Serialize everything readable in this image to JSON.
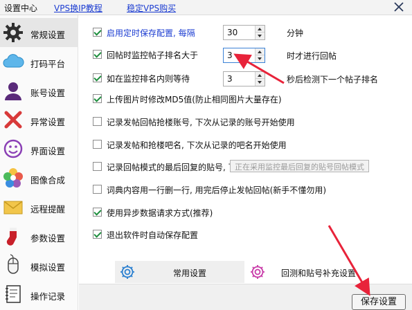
{
  "titlebar": {
    "title": "设置中心",
    "link1": "VPS换IP教程",
    "link2": "稳定VPS购买"
  },
  "sidebar": {
    "items": [
      {
        "label": "常规设置",
        "icon": "gear-icon"
      },
      {
        "label": "打码平台",
        "icon": "cloud-icon"
      },
      {
        "label": "账号设置",
        "icon": "user-icon"
      },
      {
        "label": "异常设置",
        "icon": "cross-icon"
      },
      {
        "label": "界面设置",
        "icon": "smiley-icon"
      },
      {
        "label": "图像合成",
        "icon": "flower-icon"
      },
      {
        "label": "远程提醒",
        "icon": "envelope-icon"
      },
      {
        "label": "参数设置",
        "icon": "sock-icon"
      },
      {
        "label": "模拟设置",
        "icon": "mouse-icon"
      },
      {
        "label": "操作记录",
        "icon": "notebook-icon"
      }
    ]
  },
  "settings": {
    "auto_save": {
      "label": "启用定时保存配置, 每隔",
      "value": "30",
      "unit": "分钟",
      "checked": true
    },
    "monitor_rank": {
      "label": "回帖时监控帖子排名大于",
      "value": "3",
      "unit": "时才进行回帖",
      "checked": true
    },
    "wait_in_rank": {
      "label": "如在监控排名内则等待",
      "value": "3",
      "unit": "秒后检测下一个帖子排名",
      "checked": true
    },
    "md5": {
      "label": "上传图片时修改MD5值(防止相同图片大量存在)",
      "checked": true
    },
    "record_account": {
      "label": "记录发帖回帖抢楼账号, 下次从记录的账号开始使用",
      "checked": false
    },
    "record_bar": {
      "label": "记录发帖和抢楼吧名, 下次从记录的吧名开始使用",
      "checked": false
    },
    "record_reply": {
      "label": "记录回帖模式的最后回复的贴号, 下次从下个贴号开始",
      "checked": false
    },
    "delete_line": {
      "label": "词典内容用一行删一行, 用完后停止发帖回帖(新手不懂勿用)",
      "checked": false
    },
    "async_request": {
      "label": "使用异步数据请求方式(推荐)",
      "checked": true
    },
    "exit_save": {
      "label": "退出软件时自动保存配置",
      "checked": true
    }
  },
  "tooltip": "正在采用监控最后回复的贴号回帖模式",
  "tabs": [
    {
      "label": "常用设置"
    },
    {
      "label": "回测和贴号补充设置"
    }
  ],
  "save_button": "保存设置",
  "colors": {
    "accent": "#1a3bd1",
    "check": "#1e8e3e",
    "arrow": "#e8233a"
  }
}
